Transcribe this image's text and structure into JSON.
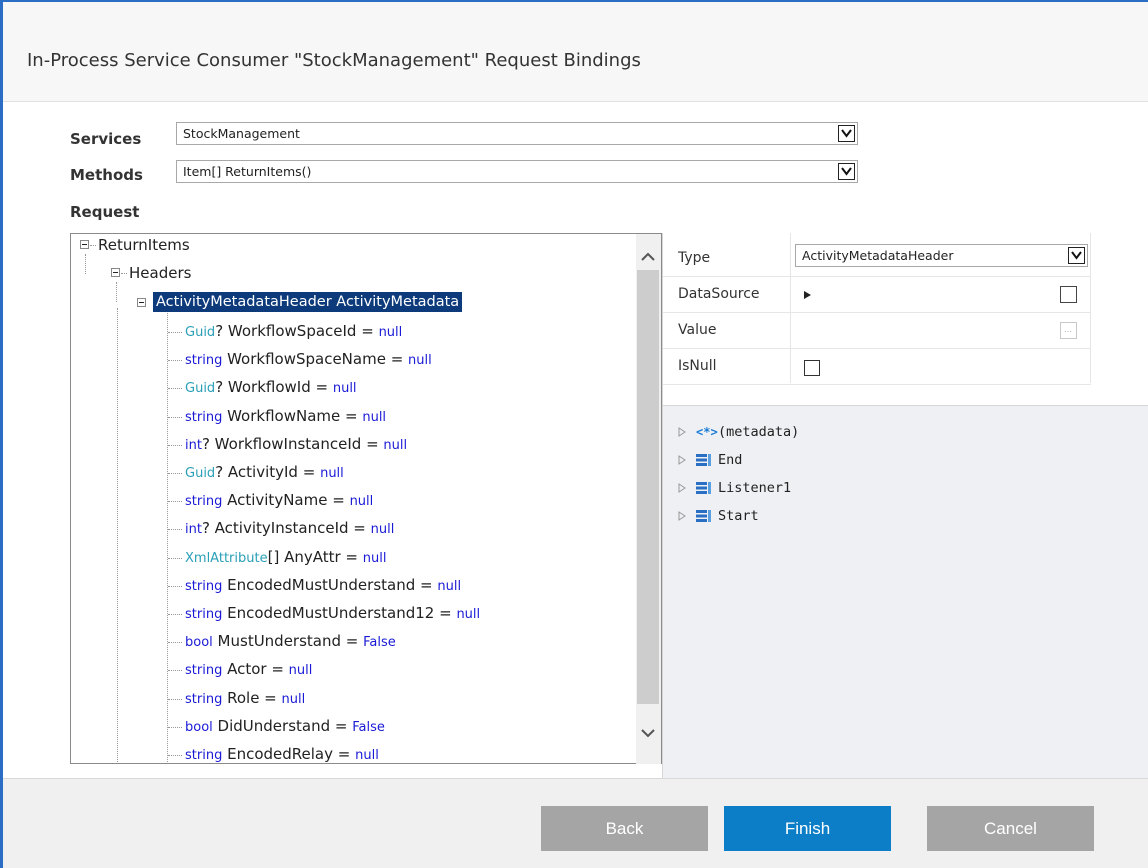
{
  "dialog": {
    "title": "In-Process Service Consumer \"StockManagement\" Request Bindings"
  },
  "form": {
    "services_label": "Services",
    "services_value": "StockManagement",
    "methods_label": "Methods",
    "methods_value": "Item[] ReturnItems()",
    "request_label": "Request"
  },
  "tree": {
    "root": "ReturnItems",
    "headers": "Headers",
    "selected_node": "ActivityMetadataHeader ActivityMetadata",
    "items": [
      {
        "type": "Guid",
        "type_kind": "type",
        "rest": "? WorkflowSpaceId = ",
        "value": "null"
      },
      {
        "type": "string",
        "type_kind": "kw",
        "rest": " WorkflowSpaceName = ",
        "value": "null"
      },
      {
        "type": "Guid",
        "type_kind": "type",
        "rest": "? WorkflowId = ",
        "value": "null"
      },
      {
        "type": "string",
        "type_kind": "kw",
        "rest": " WorkflowName = ",
        "value": "null"
      },
      {
        "type": "int",
        "type_kind": "kw",
        "rest": "? WorkflowInstanceId = ",
        "value": "null"
      },
      {
        "type": "Guid",
        "type_kind": "type",
        "rest": "? ActivityId = ",
        "value": "null"
      },
      {
        "type": "string",
        "type_kind": "kw",
        "rest": " ActivityName = ",
        "value": "null"
      },
      {
        "type": "int",
        "type_kind": "kw",
        "rest": "? ActivityInstanceId = ",
        "value": "null"
      },
      {
        "type": "XmlAttribute",
        "type_kind": "type",
        "rest": "[] AnyAttr = ",
        "value": "null"
      },
      {
        "type": "string",
        "type_kind": "kw",
        "rest": " EncodedMustUnderstand = ",
        "value": "null"
      },
      {
        "type": "string",
        "type_kind": "kw",
        "rest": " EncodedMustUnderstand12 = ",
        "value": "null"
      },
      {
        "type": "bool",
        "type_kind": "kw",
        "rest": " MustUnderstand = ",
        "value": "False"
      },
      {
        "type": "string",
        "type_kind": "kw",
        "rest": " Actor = ",
        "value": "null"
      },
      {
        "type": "string",
        "type_kind": "kw",
        "rest": " Role = ",
        "value": "null"
      },
      {
        "type": "bool",
        "type_kind": "kw",
        "rest": " DidUnderstand = ",
        "value": "False"
      },
      {
        "type": "string",
        "type_kind": "kw",
        "rest": " EncodedRelay = ",
        "value": "null"
      }
    ]
  },
  "properties": {
    "type_label": "Type",
    "type_value": "ActivityMetadataHeader",
    "datasource_label": "DataSource",
    "value_label": "Value",
    "isnull_label": "IsNull",
    "isnull_checked": false
  },
  "metadata_tree": {
    "items": [
      {
        "label": "(metadata)",
        "icon": "angle-brackets-icon"
      },
      {
        "label": "End",
        "icon": "activity-icon"
      },
      {
        "label": "Listener1",
        "icon": "activity-icon"
      },
      {
        "label": "Start",
        "icon": "activity-icon"
      }
    ]
  },
  "footer": {
    "back_label": "Back",
    "finish_label": "Finish",
    "cancel_label": "Cancel"
  },
  "colors": {
    "accent": "#0c7ec7",
    "selection": "#0c3a7a",
    "keyword": "#1a1ad6",
    "type": "#2a9fb8",
    "disabled_button": "#a5a5a5"
  }
}
